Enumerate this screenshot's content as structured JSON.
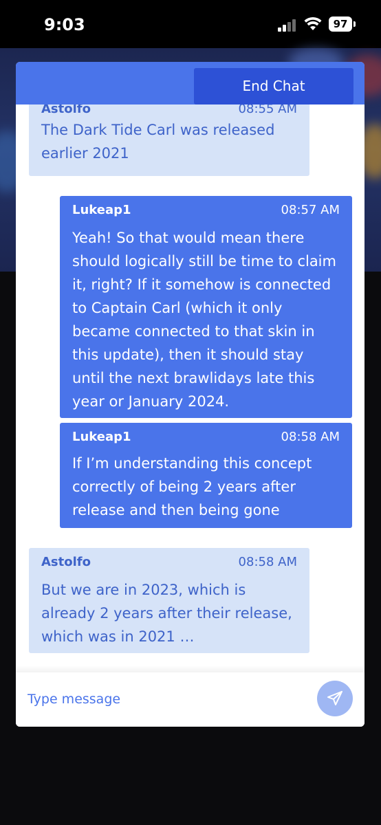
{
  "status_bar": {
    "time": "9:03",
    "battery": "97"
  },
  "header": {
    "end_chat_label": "End Chat"
  },
  "messages": [
    {
      "sender": "Astolfo",
      "time": "08:55 AM",
      "text": "The Dark Tide Carl was released earlier 2021"
    },
    {
      "sender": "Lukeap1",
      "time": "08:57 AM",
      "text": "Yeah! So that would mean there should logically still be time to claim it, right? If it somehow is connected to Captain Carl (which it only became connected to that skin in this update), then it should stay until the next brawlidays late this year or January 2024."
    },
    {
      "sender": "Lukeap1",
      "time": "08:58 AM",
      "text": "If I’m understanding this concept correctly of being 2 years after release and then being gone"
    },
    {
      "sender": "Astolfo",
      "time": "08:58 AM",
      "text": "But we are in 2023, which is already 2 years after their release, which was in 2021 …"
    }
  ],
  "composer": {
    "placeholder": "Type message"
  },
  "icons": {
    "send": "send-paper-plane-icon",
    "signal": "cellular-signal-icon",
    "wifi": "wifi-icon",
    "battery": "battery-icon"
  },
  "colors": {
    "header": "#4a74ea",
    "end_button": "#2d51d6",
    "incoming_bubble": "#d6e3f8",
    "outgoing_bubble": "#4a74ea",
    "send_button": "#9fb7f3"
  }
}
